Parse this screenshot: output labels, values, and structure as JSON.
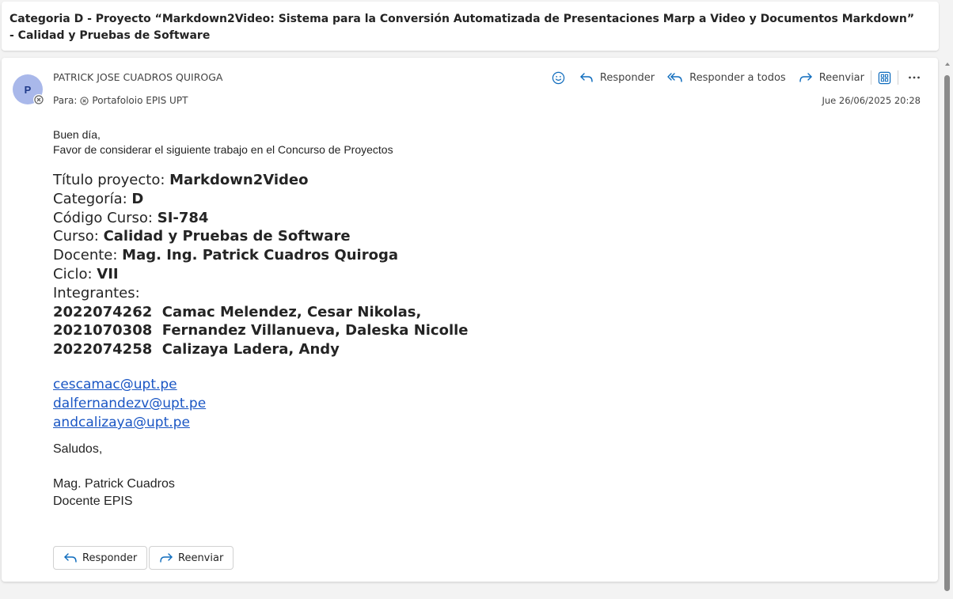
{
  "subject": "Categoria D - Proyecto “Markdown2Video: Sistema para la Conversión Automatizada de Presentaciones Marp a Video y Documentos Markdown” - Calidad y Pruebas de Software",
  "message": {
    "avatar_initial": "P",
    "sender": "PATRICK JOSE CUADROS QUIROGA",
    "to_label": "Para:",
    "recipient": "Portafoloio EPIS UPT",
    "date": "Jue 26/06/2025 20:28",
    "actions": {
      "reply": "Responder",
      "reply_all": "Responder a todos",
      "forward": "Reenviar"
    }
  },
  "body": {
    "greeting": "Buen día,",
    "intro": "Favor de considerar el siguiente trabajo en el Concurso de Proyectos",
    "fields": [
      {
        "label": "Título proyecto: ",
        "value": "Markdown2Video"
      },
      {
        "label": "Categoría: ",
        "value": "D"
      },
      {
        "label": "Código Curso: ",
        "value": "SI-784"
      },
      {
        "label": "Curso: ",
        "value": "Calidad y Pruebas de Software"
      },
      {
        "label": "Docente: ",
        "value": "Mag. Ing. Patrick Cuadros Quiroga"
      },
      {
        "label": "Ciclo: ",
        "value": "VII"
      }
    ],
    "members_label": "Integrantes:",
    "members": [
      "2022074262  Camac Melendez, Cesar Nikolas,",
      "2021070308  Fernandez Villanueva, Daleska Nicolle",
      "2022074258  Calizaya Ladera, Andy"
    ],
    "emails": [
      "cescamac@upt.pe",
      "dalfernandezv@upt.pe",
      "andcalizaya@upt.pe"
    ],
    "closing": "Saludos,",
    "signature_name": "Mag. Patrick Cuadros",
    "signature_role": "Docente EPIS"
  },
  "footer_buttons": {
    "reply": "Responder",
    "forward": "Reenviar"
  },
  "colors": {
    "accent": "#0f6cbd",
    "link": "#1a56c4",
    "avatar_bg": "#a9b8ea"
  }
}
